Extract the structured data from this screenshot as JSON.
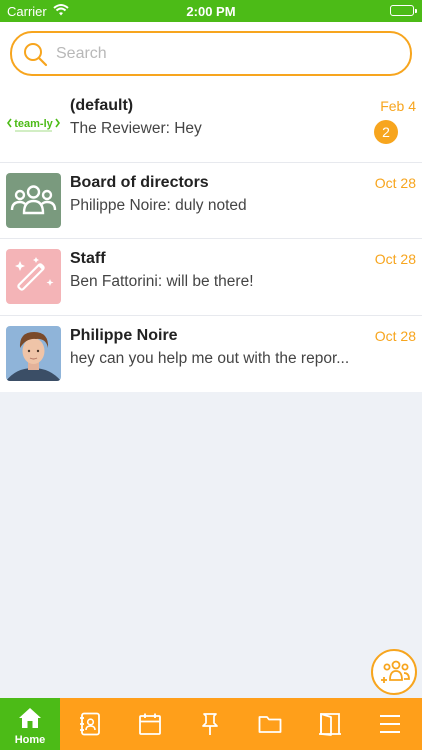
{
  "status_bar": {
    "carrier": "Carrier",
    "time": "2:00 PM"
  },
  "search": {
    "placeholder": "Search",
    "value": ""
  },
  "conversations": [
    {
      "title": "(default)",
      "preview": "The Reviewer: Hey",
      "date": "Feb 4",
      "unread": "2",
      "avatar": "team-ly-logo",
      "logo_text": "team-ly"
    },
    {
      "title": "Board of directors",
      "preview": "Philippe Noire: duly noted",
      "date": "Oct 28",
      "avatar": "group-icon"
    },
    {
      "title": "Staff",
      "preview": "Ben Fattorini: will be there!",
      "date": "Oct 28",
      "avatar": "magic-wand-icon"
    },
    {
      "title": "Philippe Noire",
      "preview": "hey can you help me out with the repor...",
      "date": "Oct 28",
      "avatar": "user-photo"
    }
  ],
  "tab_bar": {
    "tabs": [
      {
        "id": "home",
        "label": "Home",
        "icon": "home-icon",
        "active": true
      },
      {
        "id": "contacts",
        "icon": "contacts-icon"
      },
      {
        "id": "calendar",
        "icon": "calendar-icon"
      },
      {
        "id": "pinned",
        "icon": "pin-icon"
      },
      {
        "id": "files",
        "icon": "folder-icon"
      },
      {
        "id": "rooms",
        "icon": "door-icon"
      },
      {
        "id": "menu",
        "icon": "menu-icon"
      }
    ]
  },
  "colors": {
    "accent_orange": "#f7a51e",
    "tab_orange": "#ff9f1a",
    "brand_green": "#4cbb17",
    "background": "#eef1f6"
  }
}
